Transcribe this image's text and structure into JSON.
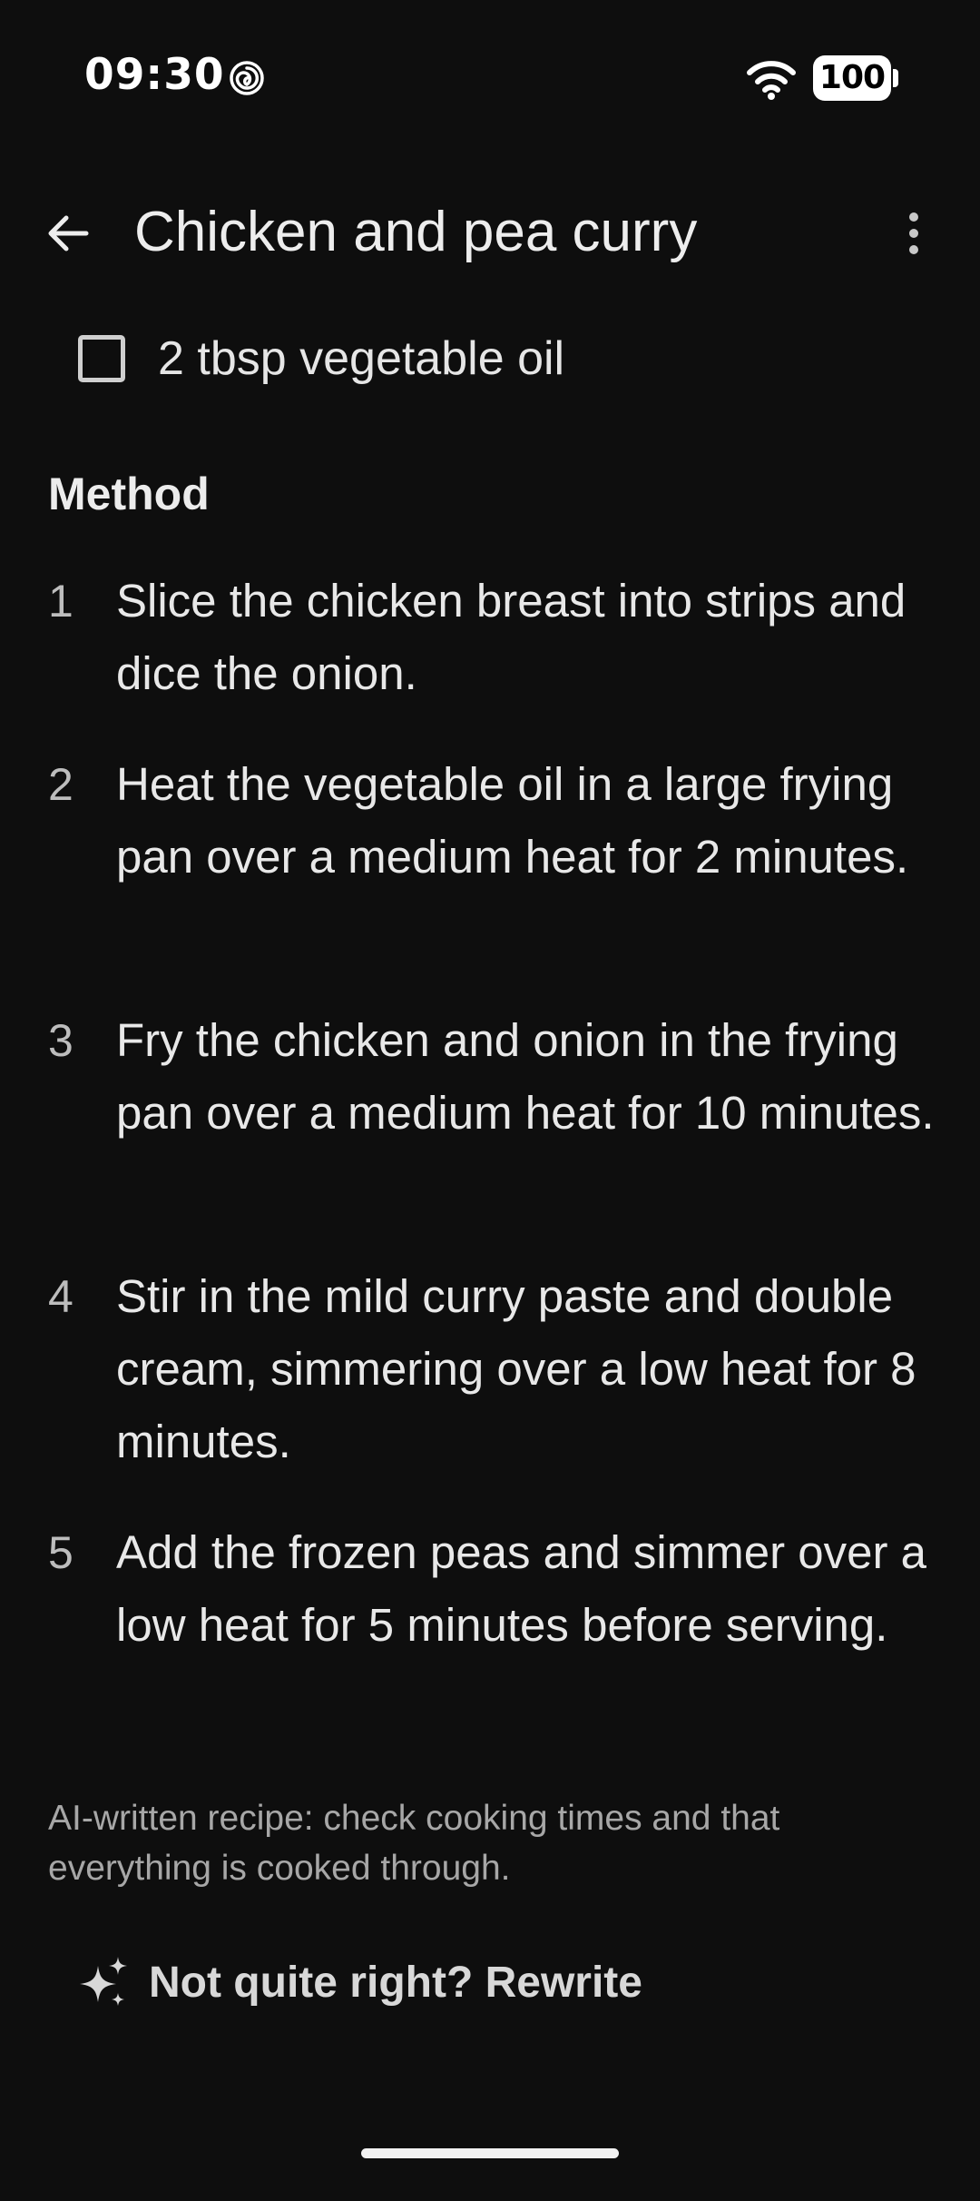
{
  "status_bar": {
    "time": "09:30",
    "battery": "100",
    "icons": [
      "spiral-notification-icon",
      "wifi-icon",
      "battery-icon"
    ]
  },
  "app_bar": {
    "title": "Chicken and pea curry",
    "back_icon": "arrow-left-icon",
    "menu_icon": "more-vertical-icon"
  },
  "ingredients": [
    {
      "label": "2 tbsp vegetable oil",
      "checked": false
    }
  ],
  "method": {
    "heading": "Method",
    "steps": [
      {
        "number": "1",
        "text": "Slice the chicken breast into strips and dice the onion."
      },
      {
        "number": "2",
        "text": "Heat the vegetable oil in a large frying pan over a medium heat for 2 minutes."
      },
      {
        "number": "3",
        "text": "Fry the chicken and onion in the frying pan over a medium heat for 10 minutes."
      },
      {
        "number": "4",
        "text": "Stir in the mild curry paste and double cream, simmering over a low heat for 8 minutes."
      },
      {
        "number": "5",
        "text": "Add the frozen peas and simmer over a low heat for 5 minutes before serving."
      }
    ]
  },
  "disclaimer": "AI-written recipe: check cooking times and that everything is cooked through.",
  "rewrite": {
    "label": "Not quite right? Rewrite",
    "icon": "sparkle-icon"
  },
  "colors": {
    "background": "#0e0e0e",
    "text": "#e8e8e8",
    "muted": "#a7a7a7"
  }
}
